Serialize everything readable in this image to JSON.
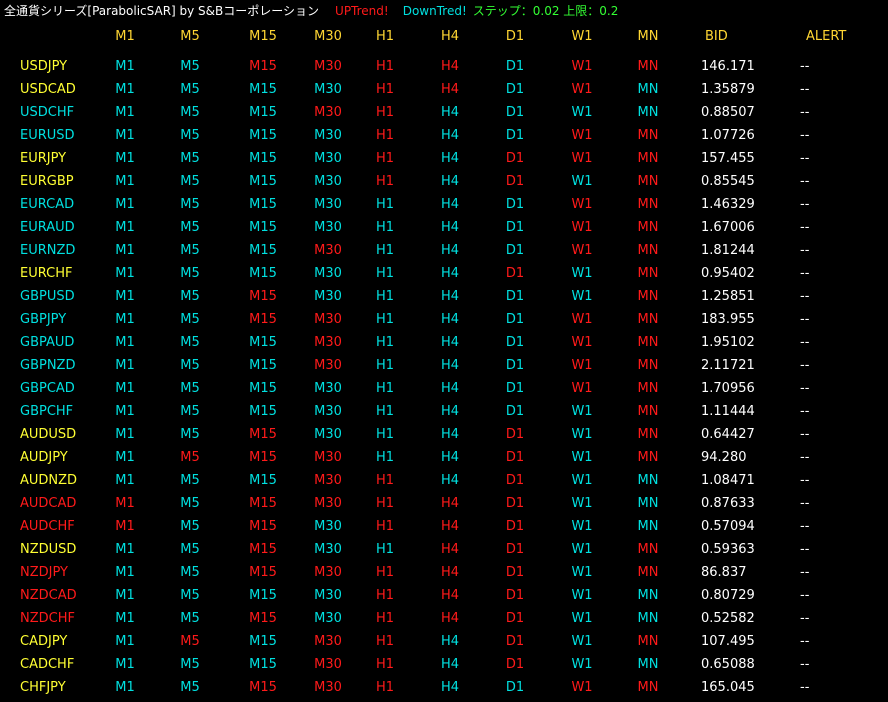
{
  "title_bar": {
    "title": "全通貨シリーズ[ParabolicSAR] by S&Bコーポレーション",
    "up_label": "UPTrend!",
    "down_label": "DownTred!",
    "step_label": "ステップ：0.02 上限：0.2"
  },
  "colors": {
    "up": "#ff1a1a",
    "down": "#00e0e0",
    "mixed": "#ffff33",
    "header": "#ffd633",
    "bid": "#ffffff",
    "alert": "#ffffff"
  },
  "headers": [
    "M1",
    "M5",
    "M15",
    "M30",
    "H1",
    "H4",
    "D1",
    "W1",
    "MN",
    "BID",
    "ALERT"
  ],
  "rows": [
    {
      "pair": "USDJPY",
      "pc": "mixed",
      "tf": [
        "d",
        "d",
        "u",
        "u",
        "u",
        "u",
        "d",
        "u",
        "u"
      ],
      "bid": "146.171",
      "alert": "--"
    },
    {
      "pair": "USDCAD",
      "pc": "mixed",
      "tf": [
        "d",
        "d",
        "d",
        "d",
        "u",
        "u",
        "d",
        "u",
        "d"
      ],
      "bid": "1.35879",
      "alert": "--"
    },
    {
      "pair": "USDCHF",
      "pc": "down",
      "tf": [
        "d",
        "d",
        "d",
        "u",
        "u",
        "d",
        "d",
        "d",
        "d"
      ],
      "bid": "0.88507",
      "alert": "--"
    },
    {
      "pair": "EURUSD",
      "pc": "down",
      "tf": [
        "d",
        "d",
        "d",
        "d",
        "u",
        "d",
        "d",
        "u",
        "u"
      ],
      "bid": "1.07726",
      "alert": "--"
    },
    {
      "pair": "EURJPY",
      "pc": "mixed",
      "tf": [
        "d",
        "d",
        "d",
        "d",
        "u",
        "d",
        "u",
        "u",
        "u"
      ],
      "bid": "157.455",
      "alert": "--"
    },
    {
      "pair": "EURGBP",
      "pc": "mixed",
      "tf": [
        "d",
        "d",
        "d",
        "d",
        "u",
        "d",
        "u",
        "d",
        "u"
      ],
      "bid": "0.85545",
      "alert": "--"
    },
    {
      "pair": "EURCAD",
      "pc": "down",
      "tf": [
        "d",
        "d",
        "d",
        "d",
        "d",
        "d",
        "d",
        "u",
        "u"
      ],
      "bid": "1.46329",
      "alert": "--"
    },
    {
      "pair": "EURAUD",
      "pc": "down",
      "tf": [
        "d",
        "d",
        "d",
        "d",
        "d",
        "d",
        "d",
        "u",
        "u"
      ],
      "bid": "1.67006",
      "alert": "--"
    },
    {
      "pair": "EURNZD",
      "pc": "down",
      "tf": [
        "d",
        "d",
        "d",
        "u",
        "d",
        "d",
        "d",
        "u",
        "u"
      ],
      "bid": "1.81244",
      "alert": "--"
    },
    {
      "pair": "EURCHF",
      "pc": "mixed",
      "tf": [
        "d",
        "d",
        "d",
        "d",
        "d",
        "d",
        "u",
        "d",
        "u"
      ],
      "bid": "0.95402",
      "alert": "--"
    },
    {
      "pair": "GBPUSD",
      "pc": "down",
      "tf": [
        "d",
        "d",
        "u",
        "d",
        "d",
        "d",
        "d",
        "d",
        "u"
      ],
      "bid": "1.25851",
      "alert": "--"
    },
    {
      "pair": "GBPJPY",
      "pc": "down",
      "tf": [
        "d",
        "d",
        "u",
        "u",
        "d",
        "d",
        "d",
        "u",
        "u"
      ],
      "bid": "183.955",
      "alert": "--"
    },
    {
      "pair": "GBPAUD",
      "pc": "down",
      "tf": [
        "d",
        "d",
        "d",
        "u",
        "d",
        "d",
        "d",
        "u",
        "u"
      ],
      "bid": "1.95102",
      "alert": "--"
    },
    {
      "pair": "GBPNZD",
      "pc": "down",
      "tf": [
        "d",
        "d",
        "d",
        "u",
        "d",
        "d",
        "d",
        "u",
        "u"
      ],
      "bid": "2.11721",
      "alert": "--"
    },
    {
      "pair": "GBPCAD",
      "pc": "down",
      "tf": [
        "d",
        "d",
        "d",
        "d",
        "d",
        "d",
        "d",
        "u",
        "u"
      ],
      "bid": "1.70956",
      "alert": "--"
    },
    {
      "pair": "GBPCHF",
      "pc": "down",
      "tf": [
        "d",
        "d",
        "d",
        "d",
        "d",
        "d",
        "d",
        "d",
        "u"
      ],
      "bid": "1.11444",
      "alert": "--"
    },
    {
      "pair": "AUDUSD",
      "pc": "mixed",
      "tf": [
        "d",
        "d",
        "u",
        "d",
        "d",
        "d",
        "u",
        "d",
        "u"
      ],
      "bid": "0.64427",
      "alert": "--"
    },
    {
      "pair": "AUDJPY",
      "pc": "mixed",
      "tf": [
        "d",
        "u",
        "u",
        "u",
        "d",
        "d",
        "u",
        "d",
        "u"
      ],
      "bid": "94.280",
      "alert": "--"
    },
    {
      "pair": "AUDNZD",
      "pc": "mixed",
      "tf": [
        "d",
        "d",
        "d",
        "u",
        "u",
        "d",
        "u",
        "d",
        "d"
      ],
      "bid": "1.08471",
      "alert": "--"
    },
    {
      "pair": "AUDCAD",
      "pc": "up",
      "tf": [
        "u",
        "d",
        "u",
        "u",
        "u",
        "u",
        "u",
        "d",
        "d"
      ],
      "bid": "0.87633",
      "alert": "--"
    },
    {
      "pair": "AUDCHF",
      "pc": "up",
      "tf": [
        "u",
        "d",
        "u",
        "d",
        "u",
        "u",
        "u",
        "d",
        "d"
      ],
      "bid": "0.57094",
      "alert": "--"
    },
    {
      "pair": "NZDUSD",
      "pc": "mixed",
      "tf": [
        "d",
        "d",
        "u",
        "d",
        "d",
        "u",
        "u",
        "d",
        "u"
      ],
      "bid": "0.59363",
      "alert": "--"
    },
    {
      "pair": "NZDJPY",
      "pc": "up",
      "tf": [
        "d",
        "d",
        "u",
        "u",
        "u",
        "u",
        "u",
        "d",
        "u"
      ],
      "bid": "86.837",
      "alert": "--"
    },
    {
      "pair": "NZDCAD",
      "pc": "up",
      "tf": [
        "d",
        "d",
        "d",
        "d",
        "u",
        "u",
        "u",
        "d",
        "d"
      ],
      "bid": "0.80729",
      "alert": "--"
    },
    {
      "pair": "NZDCHF",
      "pc": "up",
      "tf": [
        "d",
        "d",
        "u",
        "d",
        "u",
        "u",
        "u",
        "d",
        "d"
      ],
      "bid": "0.52582",
      "alert": "--"
    },
    {
      "pair": "CADJPY",
      "pc": "mixed",
      "tf": [
        "d",
        "u",
        "d",
        "u",
        "u",
        "d",
        "u",
        "d",
        "u"
      ],
      "bid": "107.495",
      "alert": "--"
    },
    {
      "pair": "CADCHF",
      "pc": "mixed",
      "tf": [
        "d",
        "d",
        "d",
        "u",
        "u",
        "d",
        "u",
        "d",
        "d"
      ],
      "bid": "0.65088",
      "alert": "--"
    },
    {
      "pair": "CHFJPY",
      "pc": "mixed",
      "tf": [
        "d",
        "d",
        "u",
        "u",
        "u",
        "d",
        "d",
        "u",
        "u"
      ],
      "bid": "165.045",
      "alert": "--"
    }
  ]
}
